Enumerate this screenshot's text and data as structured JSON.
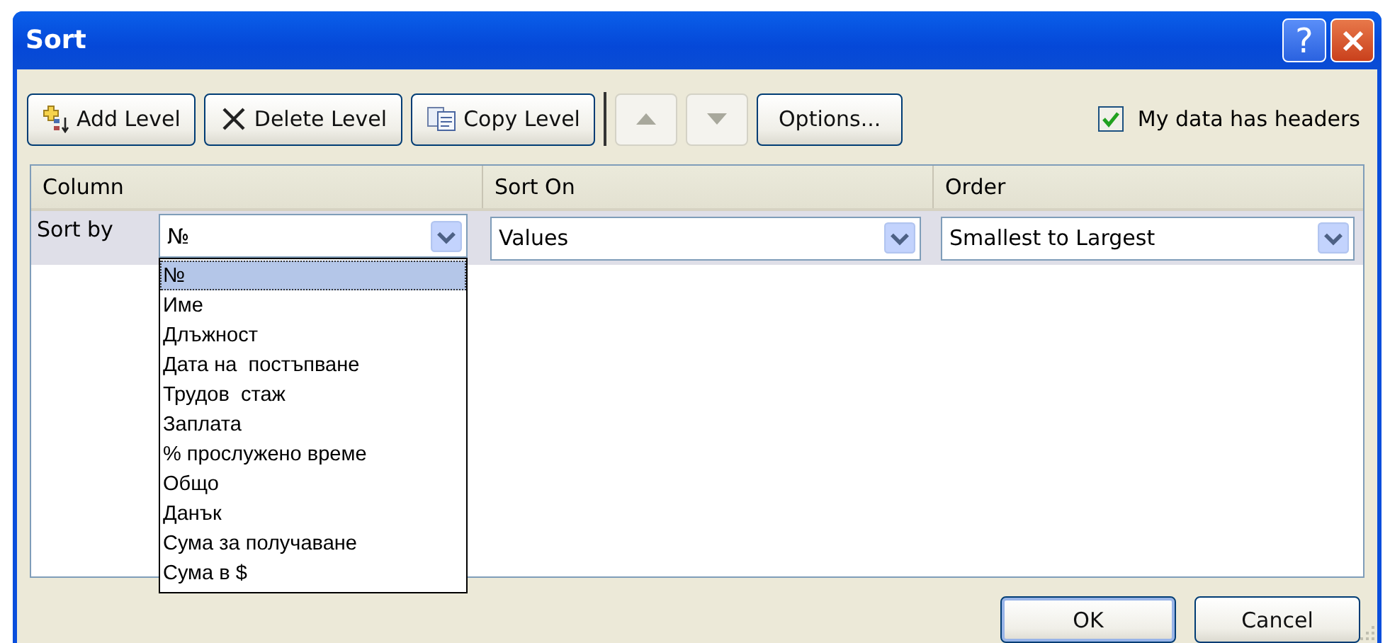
{
  "window": {
    "title": "Sort"
  },
  "title_buttons": [
    {
      "kind": "help",
      "label": "?"
    },
    {
      "kind": "close"
    }
  ],
  "toolbar": [
    {
      "kind": "add",
      "label": "Add Level",
      "disabled": false
    },
    {
      "kind": "delete",
      "label": "Delete Level",
      "disabled": false
    },
    {
      "kind": "copy",
      "label": "Copy Level",
      "disabled": false
    },
    {
      "kind": "up",
      "disabled": true
    },
    {
      "kind": "down",
      "disabled": true
    },
    {
      "kind": "options",
      "label": "Options...",
      "disabled": false
    }
  ],
  "headers_checkbox": {
    "label": "My data has headers",
    "checked": true
  },
  "columns": [
    "Column",
    "Sort On",
    "Order"
  ],
  "levels": [
    {
      "label": "Sort by",
      "column": {
        "value": "№",
        "expanded": true,
        "options": [
          {
            "label": "№",
            "selected": true
          },
          {
            "label": "Име",
            "selected": false
          },
          {
            "label": "Длъжност",
            "selected": false
          },
          {
            "label": "Дата на  постъпване",
            "selected": false
          },
          {
            "label": "Трудов  стаж",
            "selected": false
          },
          {
            "label": "Заплата",
            "selected": false
          },
          {
            "label": "% прослужено време",
            "selected": false
          },
          {
            "label": "Общо",
            "selected": false
          },
          {
            "label": "Данък",
            "selected": false
          },
          {
            "label": "Сума за получаване",
            "selected": false
          },
          {
            "label": "Сума в $",
            "selected": false
          }
        ]
      },
      "sort_on": "Values",
      "order": "Smallest to Largest"
    }
  ],
  "buttons": [
    {
      "label": "OK",
      "default": true
    },
    {
      "label": "Cancel",
      "default": false
    }
  ]
}
